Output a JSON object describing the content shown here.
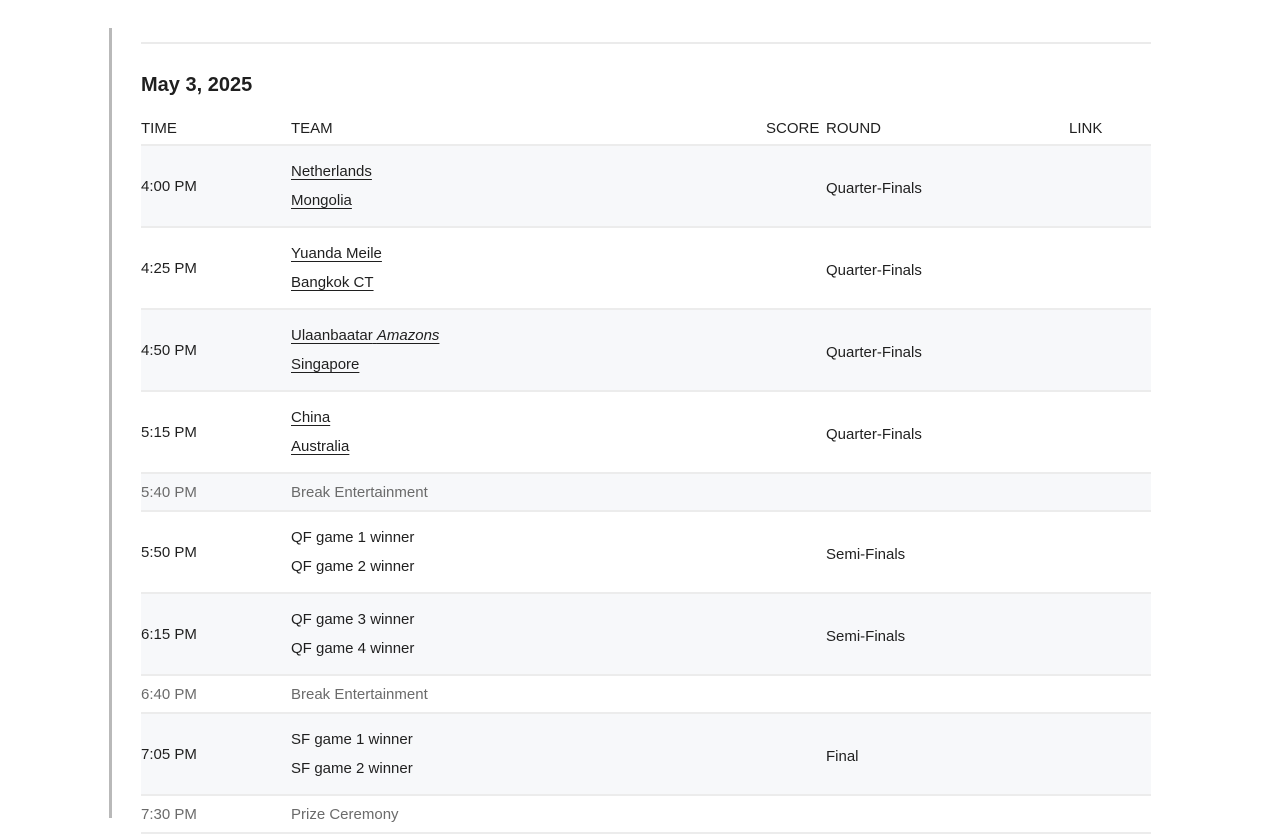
{
  "schedule": {
    "date": "May 3, 2025",
    "headers": {
      "time": "TIME",
      "team": "TEAM",
      "score": "SCORE",
      "round": "ROUND",
      "link": "LINK"
    },
    "rows": [
      {
        "time": "4:00 PM",
        "team1": "Netherlands",
        "team2": "Mongolia",
        "round": "Quarter-Finals"
      },
      {
        "time": "4:25 PM",
        "team1": "Yuanda Meile",
        "team2": "Bangkok CT",
        "round": "Quarter-Finals"
      },
      {
        "time": "4:50 PM",
        "team1_prefix": "Ulaanbaatar",
        "team1_italic": "Amazons",
        "team2": "Singapore",
        "round": "Quarter-Finals"
      },
      {
        "time": "5:15 PM",
        "team1": "China",
        "team2": "Australia",
        "round": "Quarter-Finals"
      },
      {
        "time": "5:40 PM",
        "label": "Break Entertainment"
      },
      {
        "time": "5:50 PM",
        "team1": "QF game 1 winner",
        "team2": "QF game 2 winner",
        "round": "Semi-Finals"
      },
      {
        "time": "6:15 PM",
        "team1": "QF game 3 winner",
        "team2": "QF game 4 winner",
        "round": "Semi-Finals"
      },
      {
        "time": "6:40 PM",
        "label": "Break Entertainment"
      },
      {
        "time": "7:05 PM",
        "team1": "SF game 1 winner",
        "team2": "SF game 2 winner",
        "round": "Final"
      },
      {
        "time": "7:30 PM",
        "label": "Prize Ceremony"
      }
    ]
  }
}
